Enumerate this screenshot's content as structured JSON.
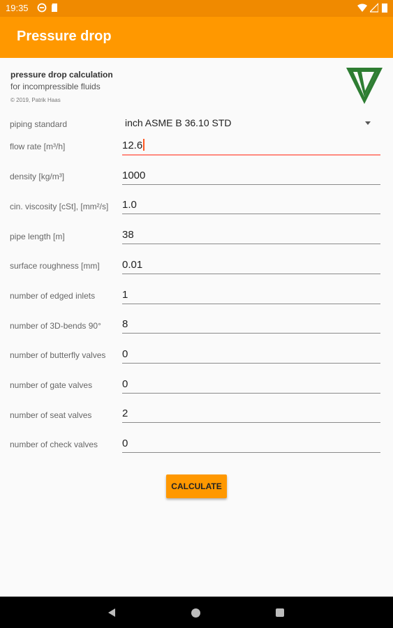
{
  "status": {
    "time": "19:35"
  },
  "toolbar": {
    "title": "Pressure drop"
  },
  "header": {
    "title": "pressure drop calculation",
    "subtitle": "for incompressible fluids",
    "copyright": "© 2019, Patrik Haas"
  },
  "piping": {
    "label": "piping standard",
    "value": "inch ASME B 36.10 STD"
  },
  "fields": [
    {
      "label": "flow rate [m³/h]",
      "value": "12.6"
    },
    {
      "label": "density [kg/m³]",
      "value": "1000"
    },
    {
      "label": "cin. viscosity [cSt], [mm²/s]",
      "value": "1.0"
    },
    {
      "label": "pipe length [m]",
      "value": "38"
    },
    {
      "label": "surface roughness [mm]",
      "value": "0.01"
    },
    {
      "label": "number of edged inlets",
      "value": "1"
    },
    {
      "label": "number of 3D-bends 90°",
      "value": "8"
    },
    {
      "label": "number of butterfly valves",
      "value": "0"
    },
    {
      "label": "number of gate valves",
      "value": "0"
    },
    {
      "label": "number of seat valves",
      "value": "2"
    },
    {
      "label": "number of check valves",
      "value": "0"
    }
  ],
  "calculate_label": "CALCULATE",
  "colors": {
    "accent": "#ff9800",
    "status": "#f08a00",
    "logo": "#2e7d32"
  }
}
